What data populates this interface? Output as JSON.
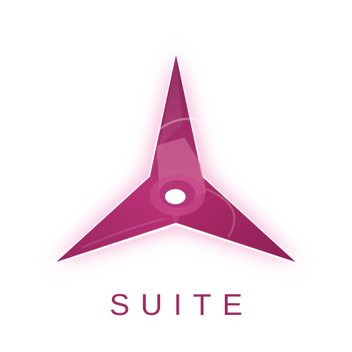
{
  "brand": {
    "name": "SUITE",
    "colors": {
      "primary": "#b52d6e",
      "dark": "#8c1f55",
      "light": "#d46a9a",
      "glow": "#f3b6d6",
      "wordmark": "#a02a62"
    },
    "logo_icon": "three-pointed-star-icon"
  }
}
